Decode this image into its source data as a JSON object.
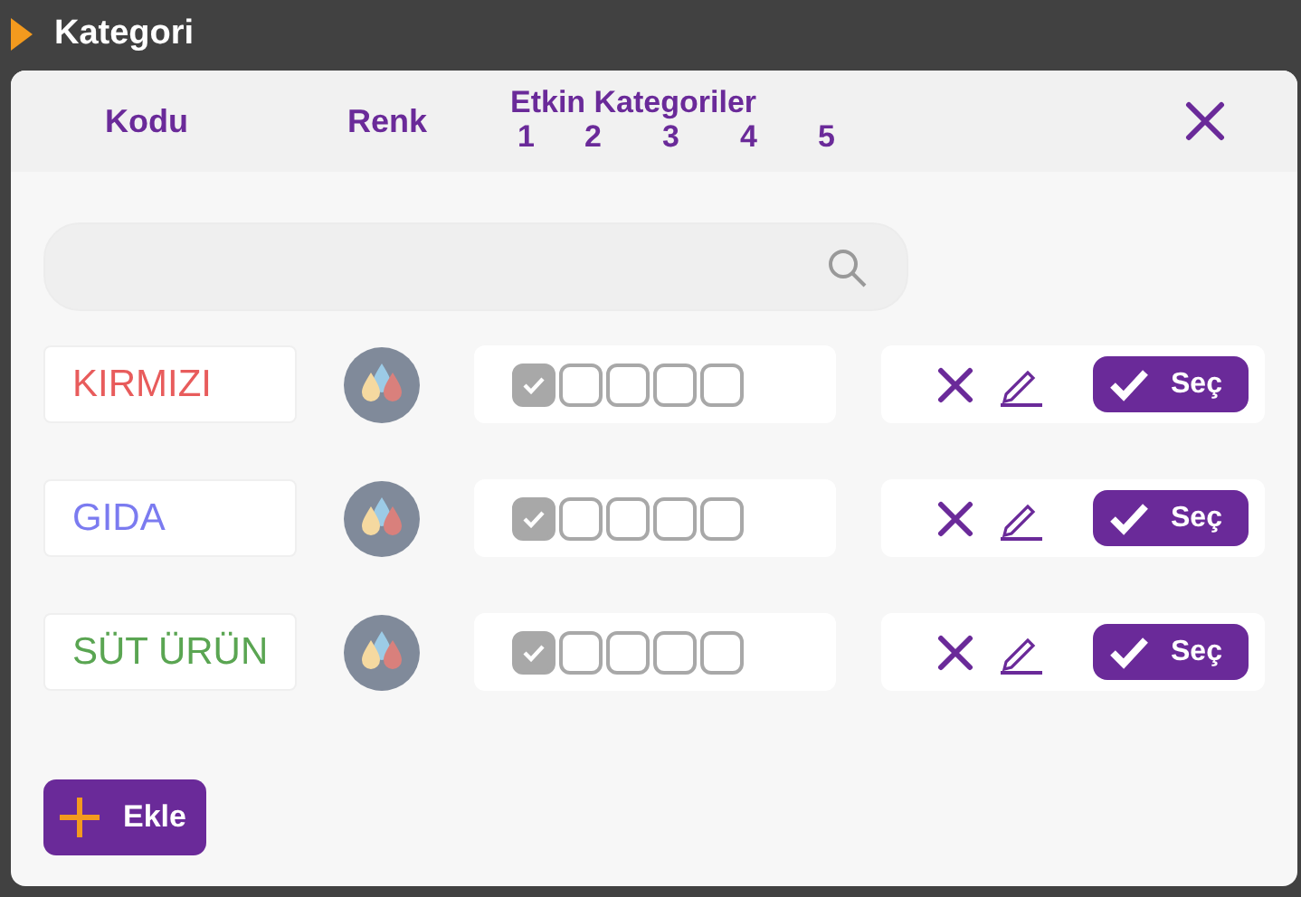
{
  "app_bar": {
    "title": "Kategori"
  },
  "header": {
    "columns": [
      "Kodu",
      "Renk"
    ],
    "active_title": "Etkin Kategoriler",
    "active_numbers": [
      "1",
      "2",
      "3",
      "4",
      "5"
    ]
  },
  "rows": [
    {
      "code": "KIRMIZI",
      "color": "#e85c5c",
      "categories": [
        {
          "checked": true
        },
        {
          "checked": false
        },
        {
          "checked": false
        },
        {
          "checked": false
        },
        {
          "checked": false
        }
      ],
      "select_label": "Seç"
    },
    {
      "code": "GIDA",
      "color": "#7b7bf0",
      "categories": [
        {
          "checked": true
        },
        {
          "checked": false
        },
        {
          "checked": false
        },
        {
          "checked": false
        },
        {
          "checked": false
        }
      ],
      "select_label": "Seç"
    },
    {
      "code": "SÜT ÜRÜN",
      "color": "#5aa552",
      "categories": [
        {
          "checked": true
        },
        {
          "checked": false
        },
        {
          "checked": false
        },
        {
          "checked": false
        },
        {
          "checked": false
        }
      ],
      "select_label": "Seç"
    }
  ],
  "add_label": "Ekle"
}
